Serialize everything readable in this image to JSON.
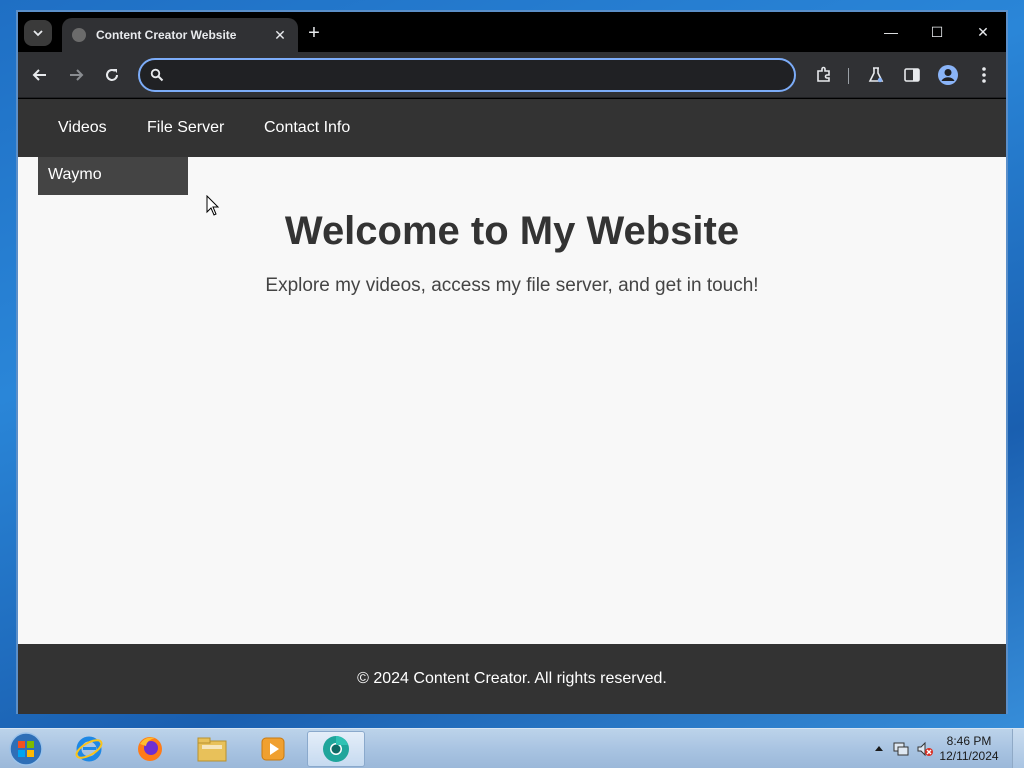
{
  "browser": {
    "tab_title": "Content Creator Website",
    "tab_close": "✕",
    "new_tab": "+",
    "controls": {
      "minimize": "—",
      "maximize": "☐",
      "close": "✕"
    },
    "omnibox": {
      "value": "",
      "placeholder": ""
    }
  },
  "site": {
    "nav": [
      {
        "label": "Videos"
      },
      {
        "label": "File Server"
      },
      {
        "label": "Contact Info"
      }
    ],
    "dropdown": [
      {
        "label": "Waymo"
      }
    ],
    "hero": {
      "title": "Welcome to My Website",
      "subtitle": "Explore my videos, access my file server, and get in touch!"
    },
    "footer": "© 2024 Content Creator. All rights reserved."
  },
  "taskbar": {
    "apps": [
      {
        "icon": "internet-explorer-icon"
      },
      {
        "icon": "firefox-icon"
      },
      {
        "icon": "file-explorer-icon"
      },
      {
        "icon": "media-player-icon"
      },
      {
        "icon": "chrome-canary-icon",
        "active": true
      }
    ],
    "clock": {
      "time": "8:46 PM",
      "date": "12/11/2024"
    }
  },
  "colors": {
    "nav_bg": "#333333",
    "dropdown_bg": "#444444",
    "page_bg": "#f8f8f8",
    "omnibox_focus": "#7cacf8"
  }
}
